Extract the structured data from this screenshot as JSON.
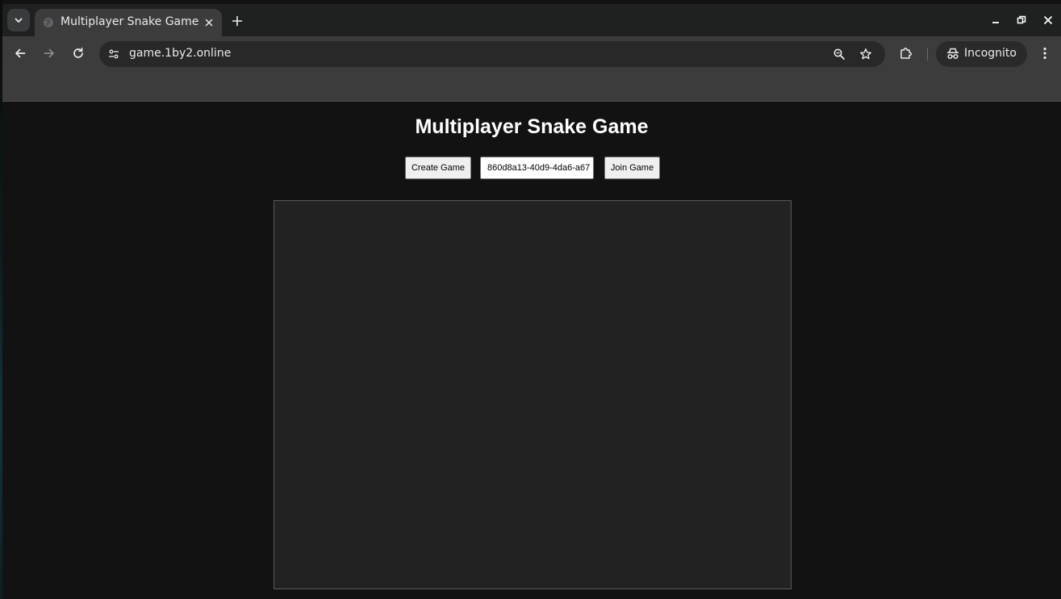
{
  "browser": {
    "tab": {
      "title": "Multiplayer Snake Game"
    },
    "address_bar": {
      "url": "game.1by2.online"
    },
    "profile": {
      "label": "Incognito"
    },
    "icons": {
      "tab_search": "chevron-down-icon",
      "favicon": "globe-icon",
      "tab_close": "close-icon",
      "new_tab": "plus-icon",
      "back": "arrow-left-icon",
      "forward": "arrow-right-icon",
      "reload": "reload-icon",
      "site_info": "tune-icon",
      "zoom": "zoom-icon",
      "bookmark": "star-icon",
      "extensions": "puzzle-icon",
      "incognito": "incognito-icon",
      "menu": "kebab-menu-icon",
      "minimize": "minimize-icon",
      "restore": "restore-icon",
      "close_window": "close-icon"
    }
  },
  "page": {
    "title": "Multiplayer Snake Game",
    "create_button_label": "Create Game",
    "game_id_value": "860d8a13-40d9-4da6-a67",
    "join_button_label": "Join Game"
  },
  "colors": {
    "page_background": "#121212",
    "canvas_background": "#222222",
    "toolbar": "#3c3c3c",
    "tabstrip": "#1f2020"
  }
}
